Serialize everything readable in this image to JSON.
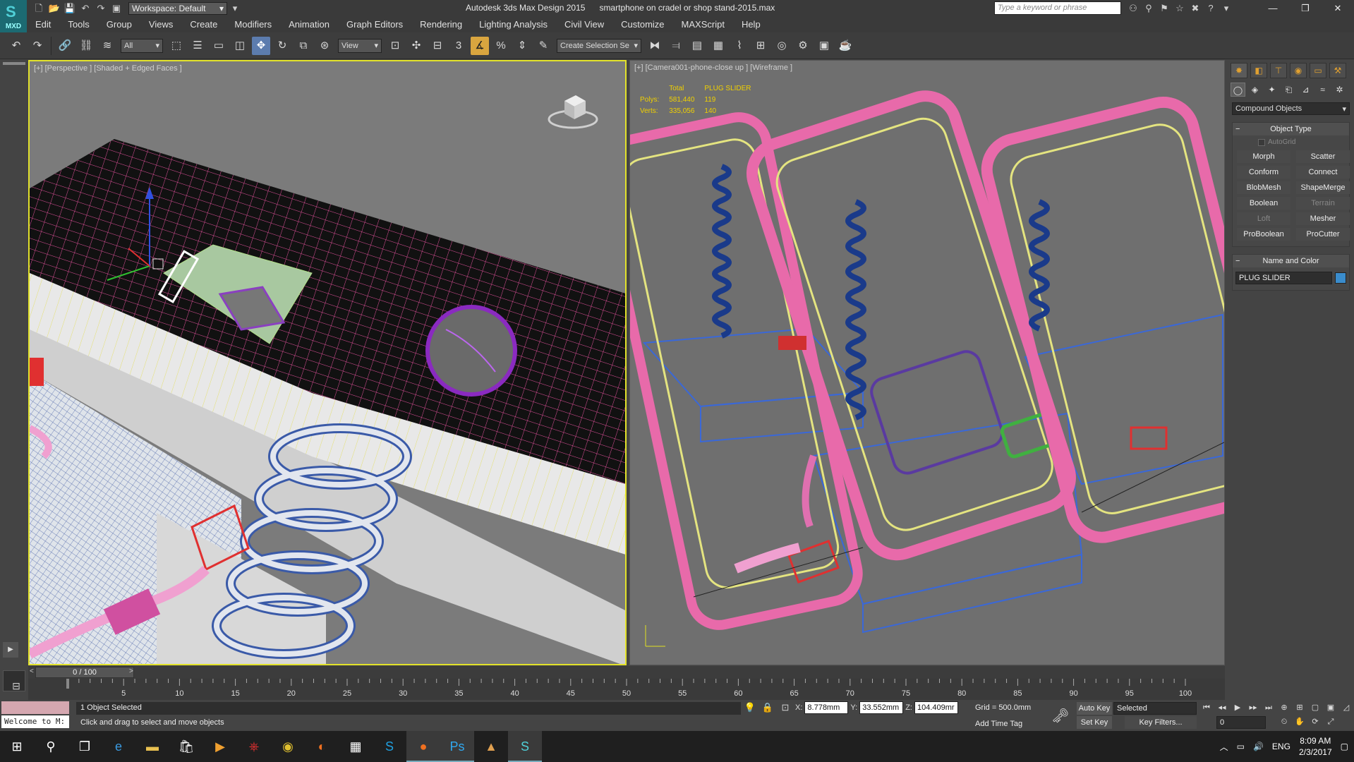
{
  "app": {
    "logo_text": "MXD",
    "title": "Autodesk 3ds Max Design 2015      smartphone on cradel or shop stand-2015.max",
    "workspace": "Workspace: Default",
    "search_placeholder": "Type a keyword or phrase"
  },
  "menu": [
    "Edit",
    "Tools",
    "Group",
    "Views",
    "Create",
    "Modifiers",
    "Animation",
    "Graph Editors",
    "Rendering",
    "Lighting Analysis",
    "Civil View",
    "Customize",
    "MAXScript",
    "Help"
  ],
  "toolbar": {
    "selection_filter": "All",
    "ref_coord": "View",
    "named_selection_placeholder": "Create Selection Se",
    "snap_label": "3"
  },
  "viewports": {
    "left_label": "[+] [Perspective ] [Shaded + Edged Faces ]",
    "right_label": "[+] [Camera001-phone-close up ] [Wireframe ]"
  },
  "stats": {
    "header_total": "Total",
    "header_object": "PLUG SLIDER",
    "polys_label": "Polys:",
    "polys_total": "581,440",
    "polys_object": "119",
    "verts_label": "Verts:",
    "verts_total": "335,056",
    "verts_object": "140"
  },
  "command_panel": {
    "category": "Compound Objects",
    "object_type_title": "Object Type",
    "autogrid": "AutoGrid",
    "buttons": [
      {
        "label": "Morph",
        "enabled": true
      },
      {
        "label": "Scatter",
        "enabled": true
      },
      {
        "label": "Conform",
        "enabled": true
      },
      {
        "label": "Connect",
        "enabled": true
      },
      {
        "label": "BlobMesh",
        "enabled": true
      },
      {
        "label": "ShapeMerge",
        "enabled": true
      },
      {
        "label": "Boolean",
        "enabled": true
      },
      {
        "label": "Terrain",
        "enabled": false
      },
      {
        "label": "Loft",
        "enabled": false
      },
      {
        "label": "Mesher",
        "enabled": true
      },
      {
        "label": "ProBoolean",
        "enabled": true
      },
      {
        "label": "ProCutter",
        "enabled": true
      }
    ],
    "name_color_title": "Name and Color",
    "object_name": "PLUG SLIDER",
    "object_color": "#3a8ccc"
  },
  "timeline": {
    "frame_display": "0 / 100",
    "ticks": [
      "5",
      "10",
      "15",
      "20",
      "25",
      "30",
      "35",
      "40",
      "45",
      "50",
      "55",
      "60",
      "65",
      "70",
      "75",
      "80",
      "85",
      "90",
      "95",
      "100"
    ]
  },
  "status": {
    "listener_text": "Welcome to M:",
    "selected_count": "1 Object Selected",
    "prompt": "Click and drag to select and move objects",
    "x_label": "X:",
    "x_value": "8.778mm",
    "y_label": "Y:",
    "y_value": "33.552mm",
    "z_label": "Z:",
    "z_value": "104.409mr",
    "grid": "Grid = 500.0mm",
    "add_time_tag": "Add Time Tag",
    "auto_key": "Auto Key",
    "set_key": "Set Key",
    "key_mode": "Selected",
    "key_filters": "Key Filters...",
    "current_frame": "0"
  },
  "taskbar": {
    "language": "ENG",
    "time": "8:09 AM",
    "date": "2/3/2017"
  }
}
